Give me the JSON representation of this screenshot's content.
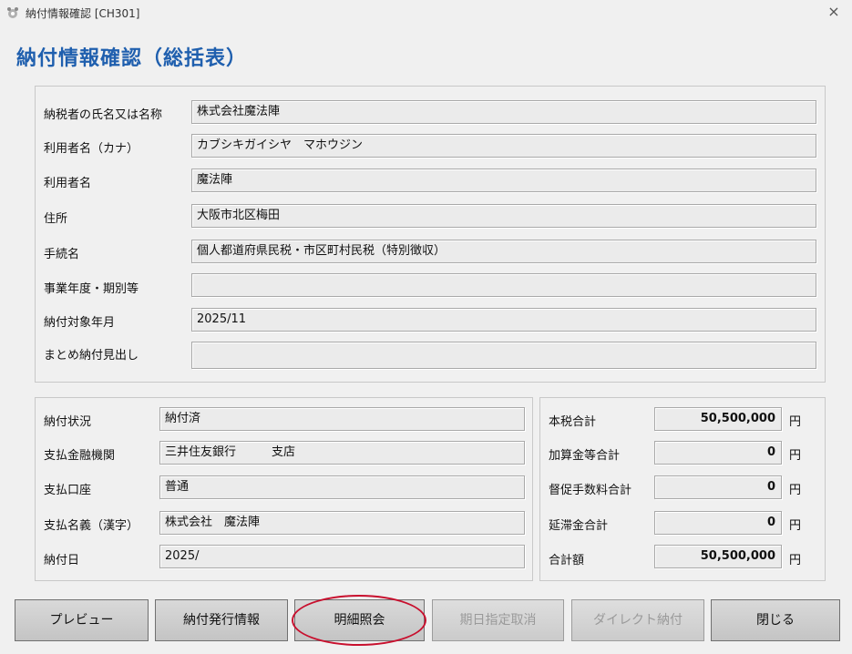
{
  "window": {
    "title": "納付情報確認 [CH301]",
    "close_glyph": "×"
  },
  "header": {
    "title": "納付情報確認（総括表）"
  },
  "info": {
    "taxpayer_name_label": "納税者の氏名又は名称",
    "taxpayer_name_value": "株式会社魔法陣",
    "user_kana_label": "利用者名（カナ）",
    "user_kana_value": "カブシキガイシヤ　マホウジン",
    "user_name_label": "利用者名",
    "user_name_value": "魔法陣",
    "address_label": "住所",
    "address_value": "大阪市北区梅田",
    "procedure_label": "手続名",
    "procedure_value": "個人都道府県民税・市区町村民税（特別徴収）",
    "fiscal_period_label": "事業年度・期別等",
    "fiscal_period_value": "",
    "target_month_label": "納付対象年月",
    "target_month_value": "2025/11",
    "bundle_heading_label": "まとめ納付見出し",
    "bundle_heading_value": ""
  },
  "payment": {
    "status_label": "納付状況",
    "status_value": "納付済",
    "bank_label": "支払金融機関",
    "bank_value": "三井住友銀行　　　支店",
    "account_label": "支払口座",
    "account_value": "普通",
    "payer_name_label": "支払名義（漢字）",
    "payer_name_value": "株式会社　魔法陣",
    "date_label": "納付日",
    "date_value": "2025/"
  },
  "totals": {
    "unit": "円",
    "tax_total_label": "本税合計",
    "tax_total_value": "50,500,000",
    "additional_total_label": "加算金等合計",
    "additional_total_value": "0",
    "reminder_fee_label": "督促手数料合計",
    "reminder_fee_value": "0",
    "delinquency_label": "延滞金合計",
    "delinquency_value": "0",
    "grand_total_label": "合計額",
    "grand_total_value": "50,500,000"
  },
  "buttons": {
    "preview": "プレビュー",
    "issue_info": "納付発行情報",
    "detail_inquiry": "明細照会",
    "cancel_scheduled": "期日指定取消",
    "direct_payment": "ダイレクト納付",
    "close": "閉じる"
  },
  "colors": {
    "title_blue": "#1f5fae",
    "highlight_red": "#c8102e"
  }
}
